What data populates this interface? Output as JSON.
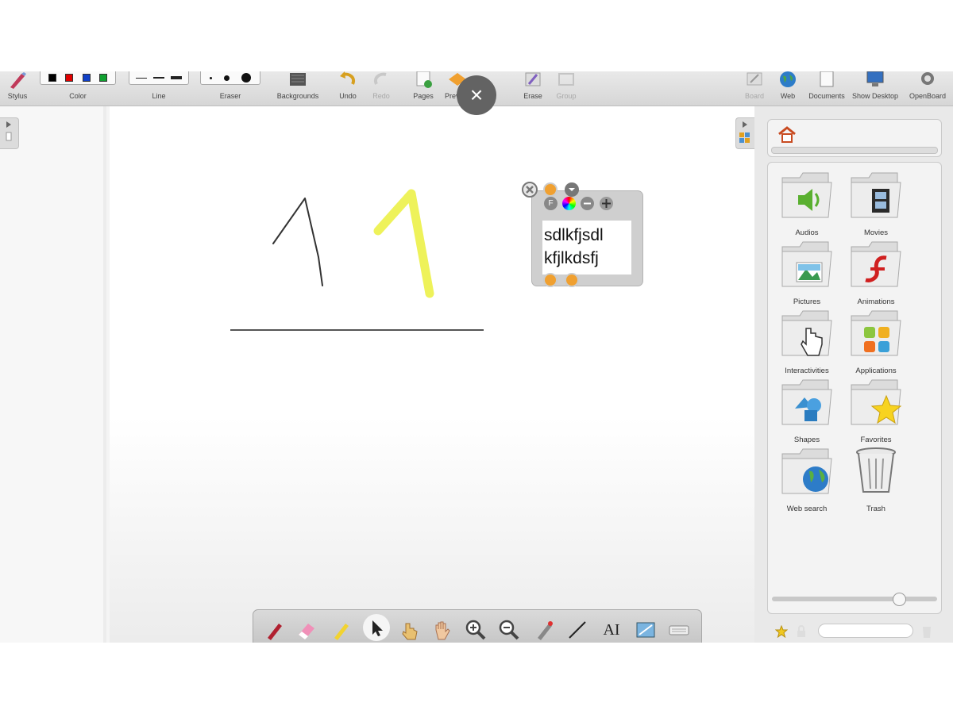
{
  "toolbar": {
    "stylus": "Stylus",
    "color": "Color",
    "line": "Line",
    "eraser": "Eraser",
    "backgrounds": "Backgrounds",
    "undo": "Undo",
    "redo": "Redo",
    "pages": "Pages",
    "preview": "Preview",
    "erase": "Erase",
    "group": "Group",
    "board": "Board",
    "web": "Web",
    "documents": "Documents",
    "show_desktop": "Show Desktop",
    "openboard": "OpenBoard",
    "colors": [
      "#000000",
      "#e00000",
      "#1040c8",
      "#10a030"
    ]
  },
  "overlay": {
    "close_glyph": "×"
  },
  "text_widget": {
    "content": "sdlkfjsdl\nkfjlkdsfj"
  },
  "library": {
    "items": [
      {
        "label": "Audios",
        "icon": "audio-folder-icon"
      },
      {
        "label": "Movies",
        "icon": "movies-folder-icon"
      },
      {
        "label": "Pictures",
        "icon": "pictures-folder-icon"
      },
      {
        "label": "Animations",
        "icon": "animations-folder-icon"
      },
      {
        "label": "Interactivities",
        "icon": "interactivities-folder-icon"
      },
      {
        "label": "Applications",
        "icon": "applications-folder-icon"
      },
      {
        "label": "Shapes",
        "icon": "shapes-folder-icon"
      },
      {
        "label": "Favorites",
        "icon": "favorites-folder-icon"
      },
      {
        "label": "Web search",
        "icon": "web-search-folder-icon"
      },
      {
        "label": "Trash",
        "icon": "trash-icon"
      }
    ]
  },
  "palette": {
    "tools": [
      "pen-icon",
      "eraser-icon",
      "marker-icon",
      "selector-icon",
      "interact-icon",
      "hand-icon",
      "zoom-in-icon",
      "zoom-out-icon",
      "laser-pointer-icon",
      "line-icon",
      "text-icon",
      "capture-icon",
      "virtual-keyboard-icon"
    ],
    "text_tool_glyph": "AI"
  },
  "strokes": {
    "pen_color": "#333333",
    "marker_color": "#eef25a",
    "line_color": "#555555"
  }
}
